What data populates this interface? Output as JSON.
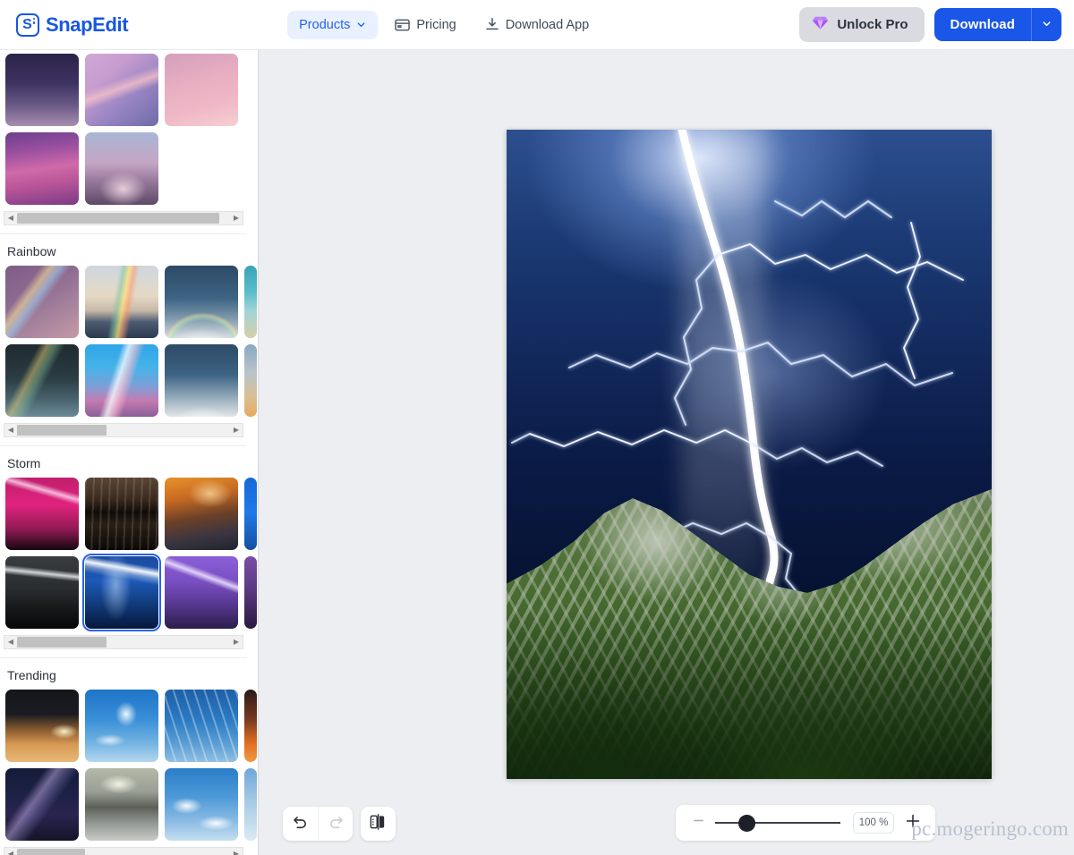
{
  "header": {
    "logo_text": "SnapEdit",
    "nav": [
      {
        "label": "Products",
        "icon": "chevron-down-icon",
        "active": true
      },
      {
        "label": "Pricing",
        "icon": "window-icon",
        "active": false
      },
      {
        "label": "Download App",
        "icon": "download-icon",
        "active": false
      }
    ],
    "unlock_pro_label": "Unlock Pro",
    "unlock_pro_icon": "diamond-icon",
    "download_label": "Download",
    "download_caret_icon": "chevron-down-icon",
    "accent_color": "#1a56e8",
    "nav_active_bg": "#e9f0ff"
  },
  "sidebar": {
    "categories": [
      {
        "title": "",
        "title_visible": false,
        "rows": [
          [
            "purple-night-sky",
            "pink-rainbow-sky",
            "pink-clouds"
          ],
          [
            "magenta-streak-sky",
            "pink-cloud-formation"
          ]
        ]
      },
      {
        "title": "Rainbow",
        "title_visible": true,
        "rows": [
          [
            "rainbow-purple-field",
            "rainbow-over-mountains",
            "rainbow-clouds-blue",
            "rainbow-teal-edge"
          ],
          [
            "rainbow-dark-sea",
            "rainbow-pink-blue",
            "rainbow-white-clouds",
            "rainbow-sunset-edge"
          ]
        ]
      },
      {
        "title": "Storm",
        "title_visible": true,
        "rows": [
          [
            "pink-lightning-storm",
            "dark-storm-shelf-cloud",
            "orange-storm-clouds",
            "blue-storm-edge"
          ],
          [
            "grey-lightning-night",
            "blue-lightning-selected",
            "purple-lightning",
            "violet-storm-edge"
          ]
        ],
        "selected": {
          "row": 1,
          "index": 1,
          "name": "blue-lightning-selected"
        }
      },
      {
        "title": "Trending",
        "title_visible": true,
        "rows": [
          [
            "golden-sunset-horizon",
            "blue-sky-wispy-clouds",
            "blue-sky-cirrus",
            "orange-sunset-edge"
          ],
          [
            "milky-way-night",
            "sun-behind-clouds",
            "blue-sky-cumulus",
            "sky-edge"
          ]
        ]
      }
    ],
    "scroll": {
      "up_arrow_icon": "caret-up-icon",
      "down_arrow_icon": "caret-down-icon",
      "left_arrow_icon": "caret-left-icon",
      "right_arrow_icon": "caret-right-icon"
    }
  },
  "canvas": {
    "image_name": "lightning-strike-over-green-mountain-valley",
    "selected_sky_name": "blue-lightning-selected"
  },
  "toolbar": {
    "undo_icon": "undo-icon",
    "redo_icon": "redo-icon",
    "compare_icon": "compare-split-icon",
    "undo_enabled": true,
    "redo_enabled": false,
    "zoom_out_icon": "minus-icon",
    "zoom_in_icon": "plus-icon",
    "zoom_value": "100 %",
    "zoom_percent": 100
  },
  "watermark": {
    "text": "pc.mogeringo.com"
  }
}
